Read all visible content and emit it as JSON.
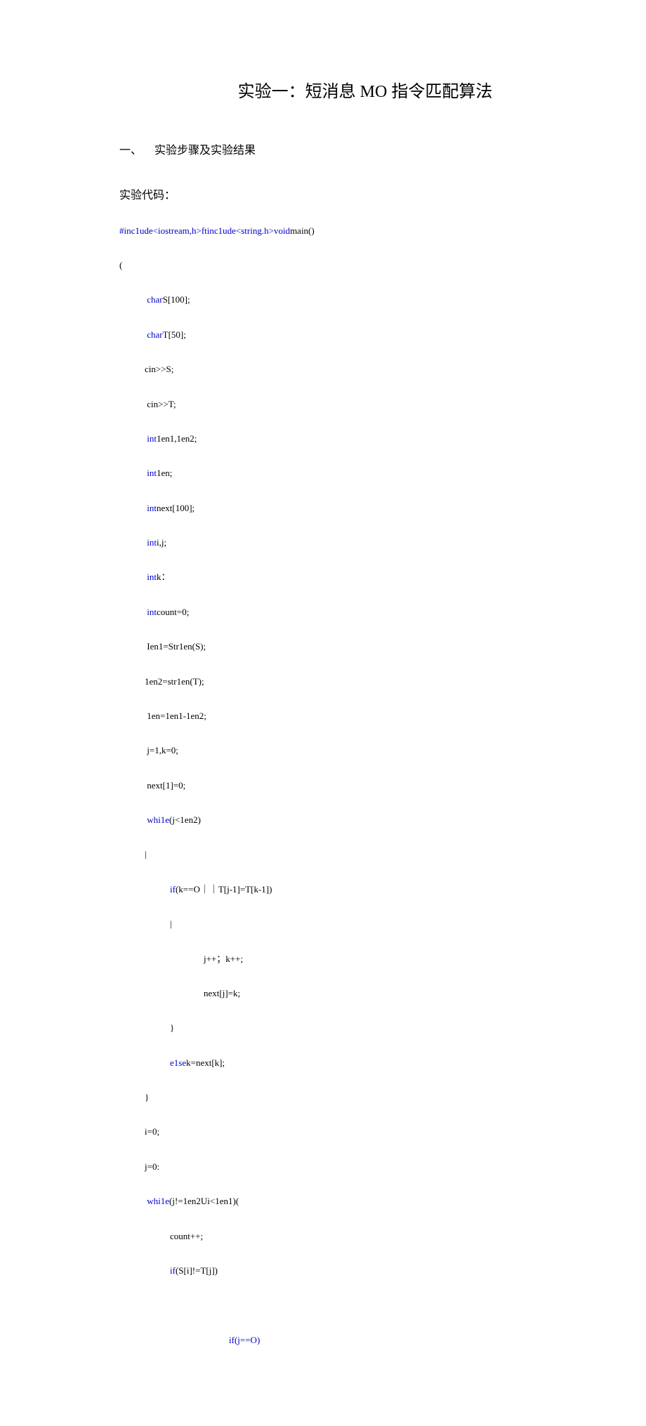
{
  "title": "实验一：短消息 MO 指令匹配算法",
  "section": {
    "number": "一、",
    "heading": "实验步骤及实验结果"
  },
  "experiment_label": "实验代码：",
  "code": {
    "l1a": "#inc1ude<iostream,h>ftinc1ude<string.h>void",
    "l1b": "main()",
    "l2": "(",
    "l3a": "char",
    "l3b": "S[100];",
    "l4a": "char",
    "l4b": "T[50];",
    "l5": "cin>>S;",
    "l6": "cin>>T;",
    "l7a": "int",
    "l7b": "1en1,1en2;",
    "l8a": "int",
    "l8b": "1en;",
    "l9a": "int",
    "l9b": "next[100];",
    "l10a": "int",
    "l10b": "i,j;",
    "l11a": "int",
    "l11b": "k：",
    "l12a": "int",
    "l12b": "count=0;",
    "l13": "Ien1=Str1en(S);",
    "l14": "1en2=str1en(T);",
    "l15": "1en=1en1-1en2;",
    "l16": "j=1,k=0;",
    "l17": "next[1]=0;",
    "l18a": "whi1e",
    "l18b": "(j<1en2)",
    "l19": "|",
    "l20a": "if",
    "l20b": "(k==O｜｜T[j-1]=T[k-1])",
    "l21": "|",
    "l22": "j++；k++;",
    "l23": "next[j]=k;",
    "l24": "}",
    "l25a": "e1se",
    "l25b": "k=next[k];",
    "l26": "}",
    "l27": "i=0;",
    "l28": "j=0:",
    "l29a": "whi1e",
    "l29b": "(j!=1en2Ui<1en1)(",
    "l30": "count++;",
    "l31a": "if",
    "l31b": "(S[i]!=T[j])",
    "l32a": "if",
    "l32b": "(j==O)"
  }
}
